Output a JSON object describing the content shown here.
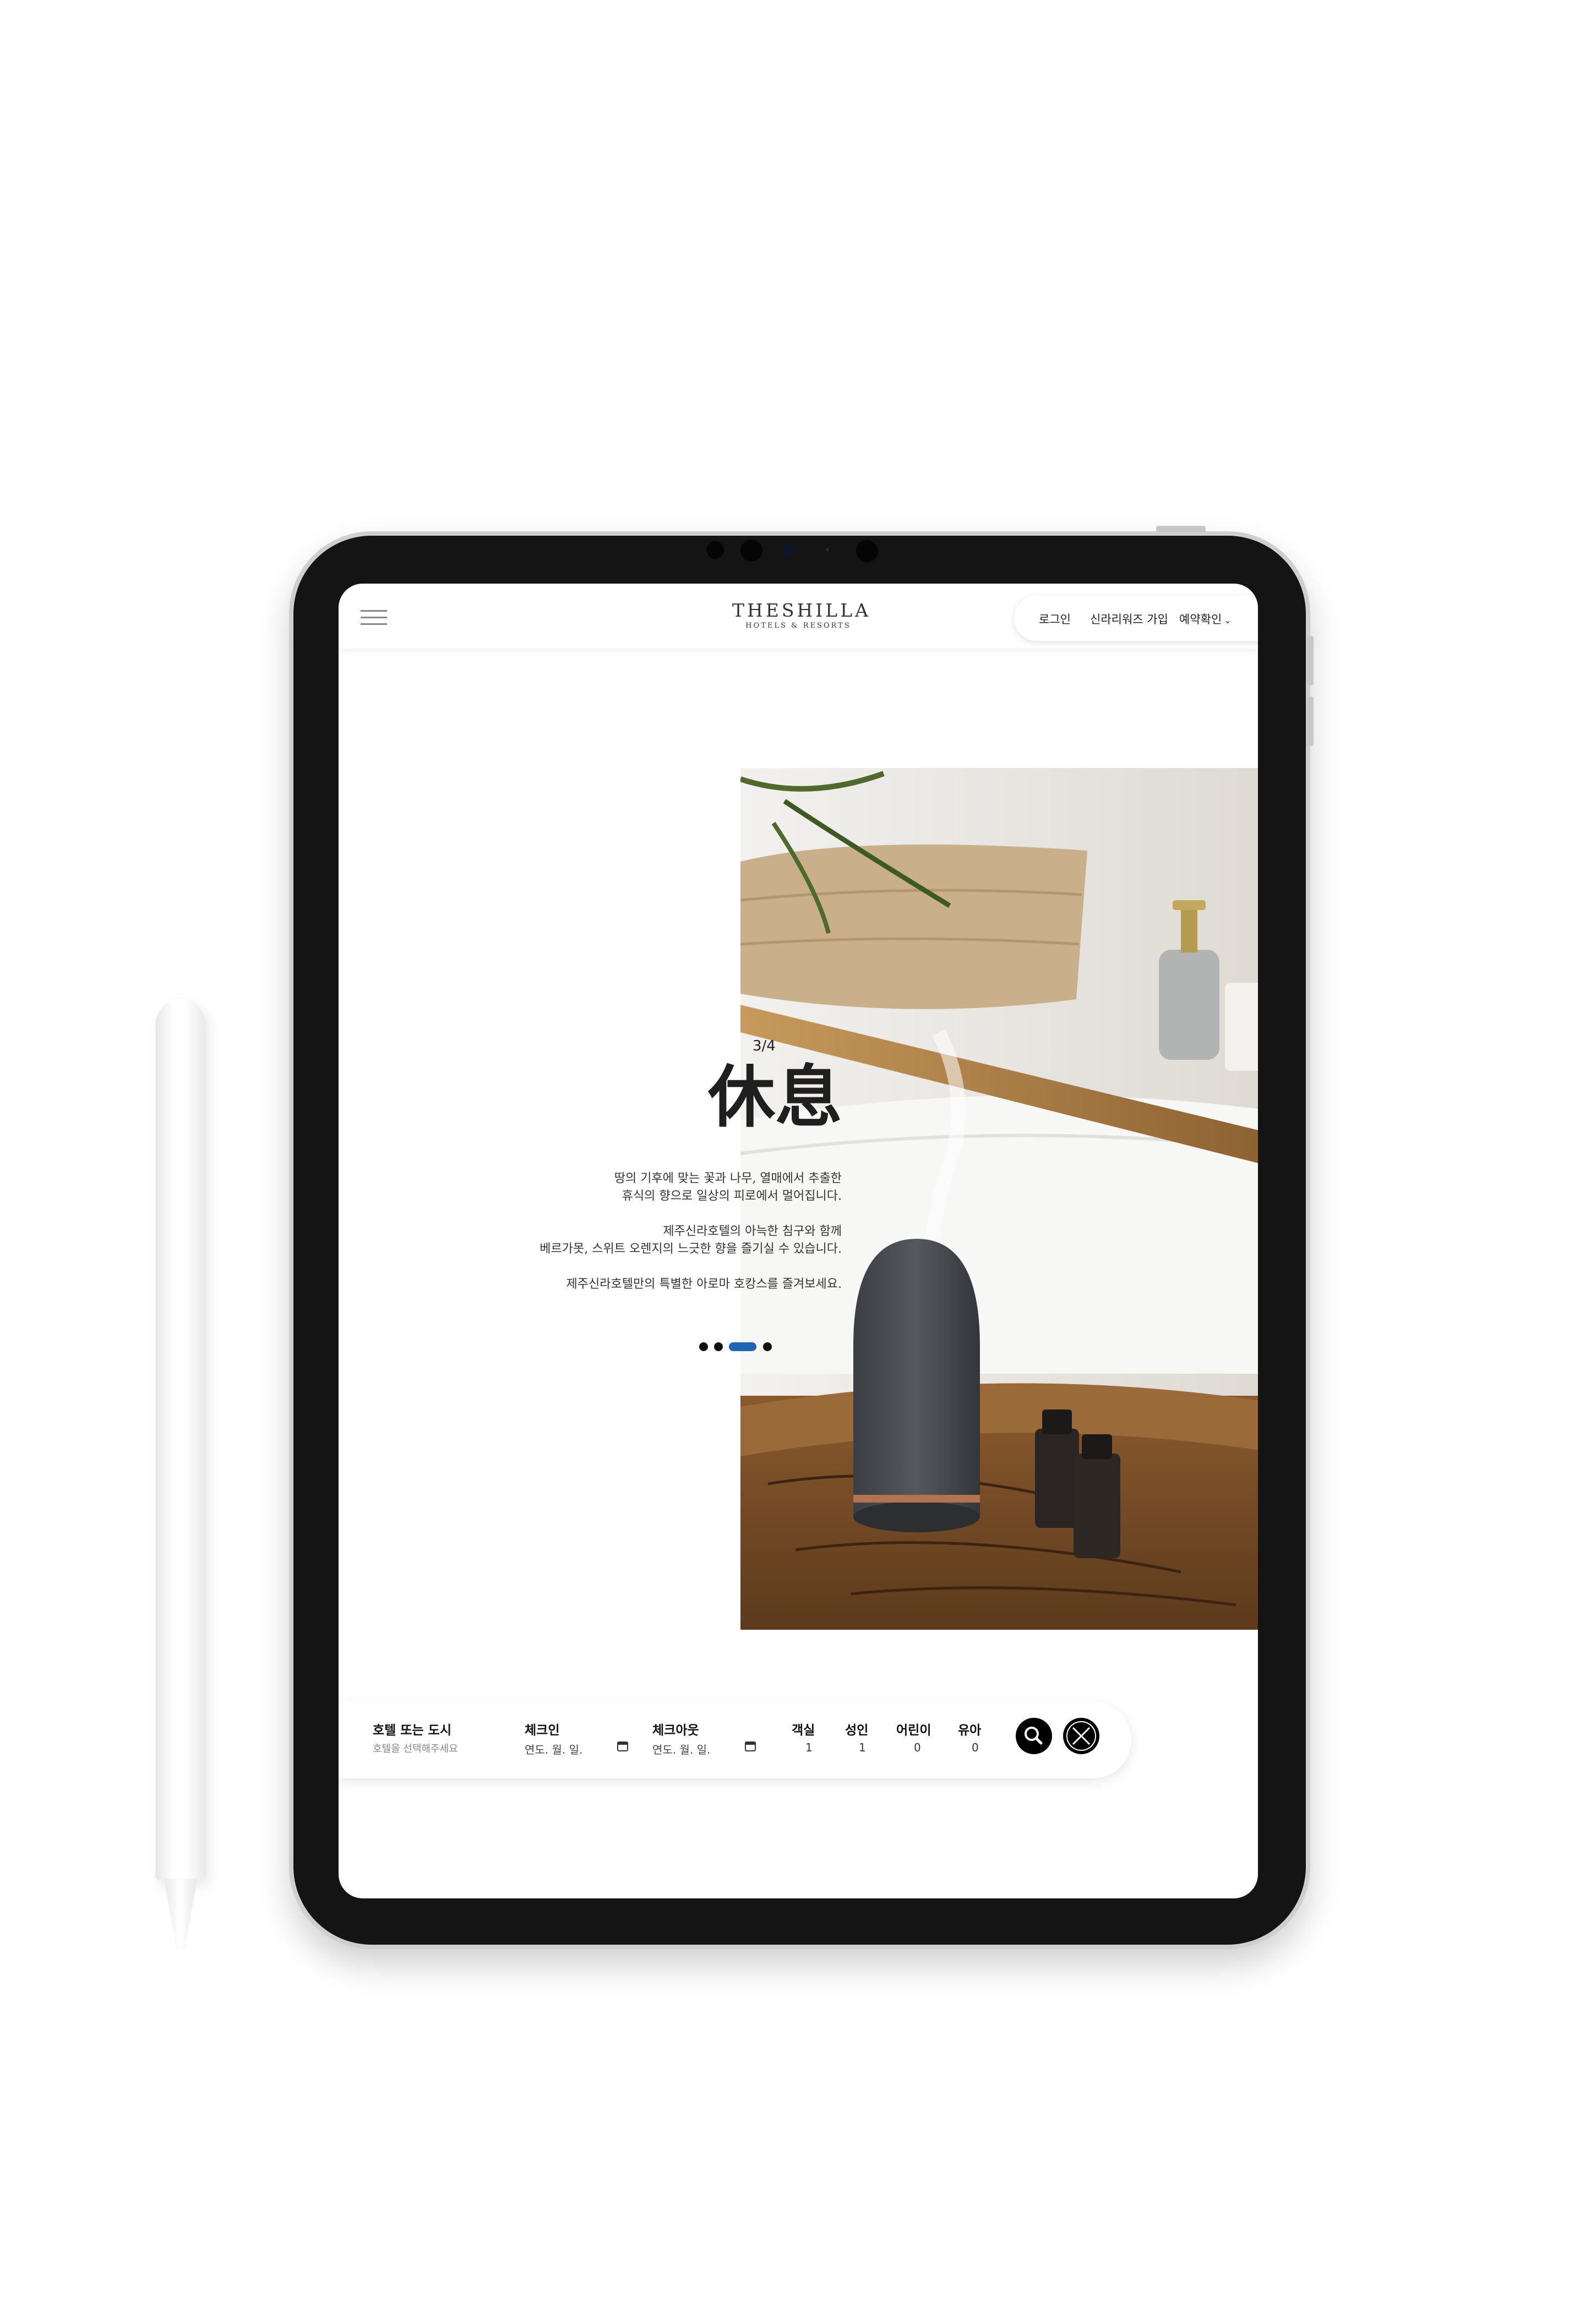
{
  "header": {
    "logo_main": "THESHILLA",
    "logo_sub": "HOTELS & RESORTS",
    "links": {
      "login": "로그인",
      "join": "신라리워즈 가입",
      "reservation": "예약확인"
    }
  },
  "hero": {
    "counter": "3/4",
    "title": "休息",
    "description": [
      [
        "땅의 기후에 맞는 꽃과 나무, 열매에서 추출한",
        "휴식의 향으로 일상의 피로에서 멀어집니다."
      ],
      [
        "제주신라호텔의 아늑한 침구와 함께",
        "베르가못, 스위트 오렌지의 느긋한 향을 즐기실 수 있습니다."
      ],
      [
        "제주신라호텔만의 특별한 아로마 호캉스를 즐겨보세요."
      ]
    ],
    "slide_total": 4,
    "slide_active": 3,
    "accent_color": "#1d64b5"
  },
  "booking": {
    "hotel_label": "호텔 또는 도시",
    "hotel_placeholder": "호텔을 선택해주세요",
    "checkin_label": "체크인",
    "checkin_value": "연도. 월. 일.",
    "checkout_label": "체크아웃",
    "checkout_value": "연도. 월. 일.",
    "rooms_label": "객실",
    "rooms_value": "1",
    "adults_label": "성인",
    "adults_value": "1",
    "children_label": "어린이",
    "children_value": "0",
    "infants_label": "유아",
    "infants_value": "0",
    "search_icon": "search-icon",
    "close_icon": "close-icon"
  }
}
